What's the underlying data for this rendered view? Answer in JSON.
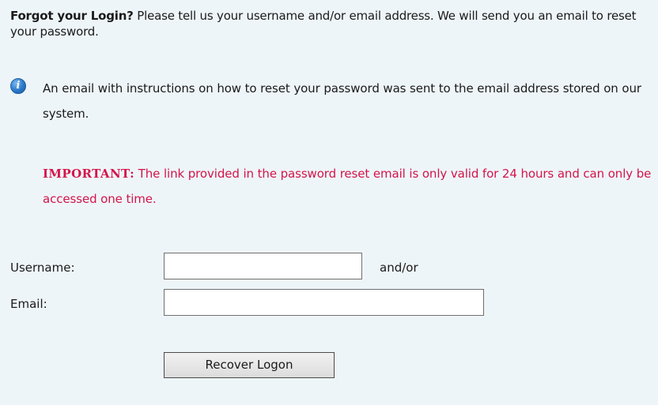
{
  "intro": {
    "heading": "Forgot your Login?",
    "text": "Please tell us your username and/or email address.  We will send you an email to reset your password."
  },
  "info": {
    "icon": "info-icon",
    "icon_glyph": "i",
    "message": "An email with instructions on how to reset your password was sent to the email address stored on our system."
  },
  "important": {
    "label": "IMPORTANT:",
    "text": "The link provided in the password reset email is only valid for 24 hours and can only be accessed one time.",
    "color": "#d4144a"
  },
  "form": {
    "username_label": "Username:",
    "username_value": "",
    "and_or": "and/or",
    "email_label": "Email:",
    "email_value": "",
    "submit_label": "Recover Logon"
  },
  "colors": {
    "background": "#eef5f8",
    "info_icon": "#2a78c8"
  }
}
